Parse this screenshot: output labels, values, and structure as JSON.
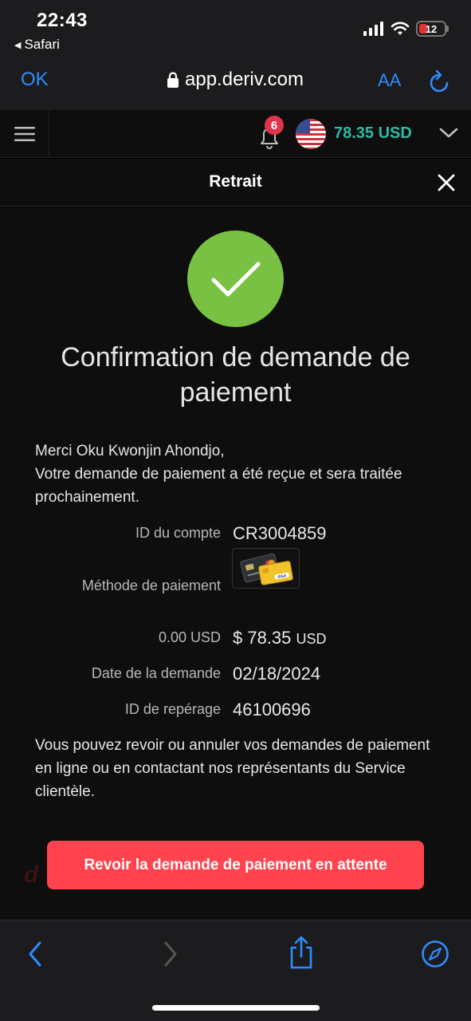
{
  "status_bar": {
    "time": "22:43",
    "back_app": "Safari",
    "battery": "12"
  },
  "safari": {
    "done_label": "OK",
    "url": "app.deriv.com",
    "aa_label": "AA"
  },
  "header": {
    "notification_count": "6",
    "balance": "78.35 USD"
  },
  "modal": {
    "title": "Retrait"
  },
  "confirmation": {
    "title": "Confirmation de demande de paiement",
    "greeting": "Merci Oku Kwonjin Ahondjo,",
    "message": "Votre demande de paiement a été reçue et sera traitée prochainement."
  },
  "details": {
    "account_id_label": "ID du compte",
    "account_id": "CR3004859",
    "payment_method_label": "Méthode de paiement",
    "amount_label": "0.00 USD",
    "amount_value": "$ 78.35",
    "amount_unit": "USD",
    "request_date_label": "Date de la demande",
    "request_date": "02/18/2024",
    "tracking_id_label": "ID de repérage",
    "tracking_id": "46100696"
  },
  "footer_text": "Vous pouvez revoir ou annuler vos demandes de paiement en ligne ou en contactant nos représentants du Service clientèle.",
  "review_button": "Revoir la demande de paiement en attente",
  "colors": {
    "accent": "#ff444f",
    "success": "#79c143",
    "balance": "#2fb9a6",
    "safari_blue": "#2f8cff"
  },
  "icons": [
    "signal-icon",
    "wifi-icon",
    "battery-icon",
    "lock-icon",
    "reload-icon",
    "menu-icon",
    "bell-icon",
    "us-flag-icon",
    "chevron-down-icon",
    "close-icon",
    "checkmark-icon",
    "credit-card-icon",
    "back-icon",
    "forward-icon",
    "share-icon",
    "compass-icon"
  ]
}
